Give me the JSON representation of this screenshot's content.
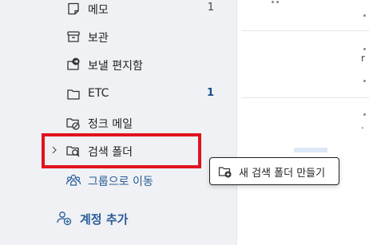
{
  "folders": [
    {
      "label": "메모",
      "count": "1",
      "icon": "note-icon"
    },
    {
      "label": "보관",
      "count": "",
      "icon": "archive-icon"
    },
    {
      "label": "보낼 편지함",
      "count": "",
      "icon": "outbox-icon"
    },
    {
      "label": "ETC",
      "count": "1",
      "icon": "folder-icon"
    },
    {
      "label": "정크 메일",
      "count": "",
      "icon": "junk-folder-icon"
    },
    {
      "label": "검색 폴더",
      "count": "",
      "icon": "search-folder-icon",
      "selected": true
    },
    {
      "label": "그룹으로 이동",
      "count": "",
      "icon": "groups-icon"
    }
  ],
  "account": {
    "add_label": "계정 추가"
  },
  "context_menu": {
    "new_search_folder_label": "새 검색 폴더 만들기"
  },
  "message_list": {
    "fragments": [
      "r",
      "."
    ]
  },
  "colors": {
    "pane_bg": "#eff1f4",
    "accent_blue": "#2a5c98",
    "highlight_red": "#e0141e"
  }
}
